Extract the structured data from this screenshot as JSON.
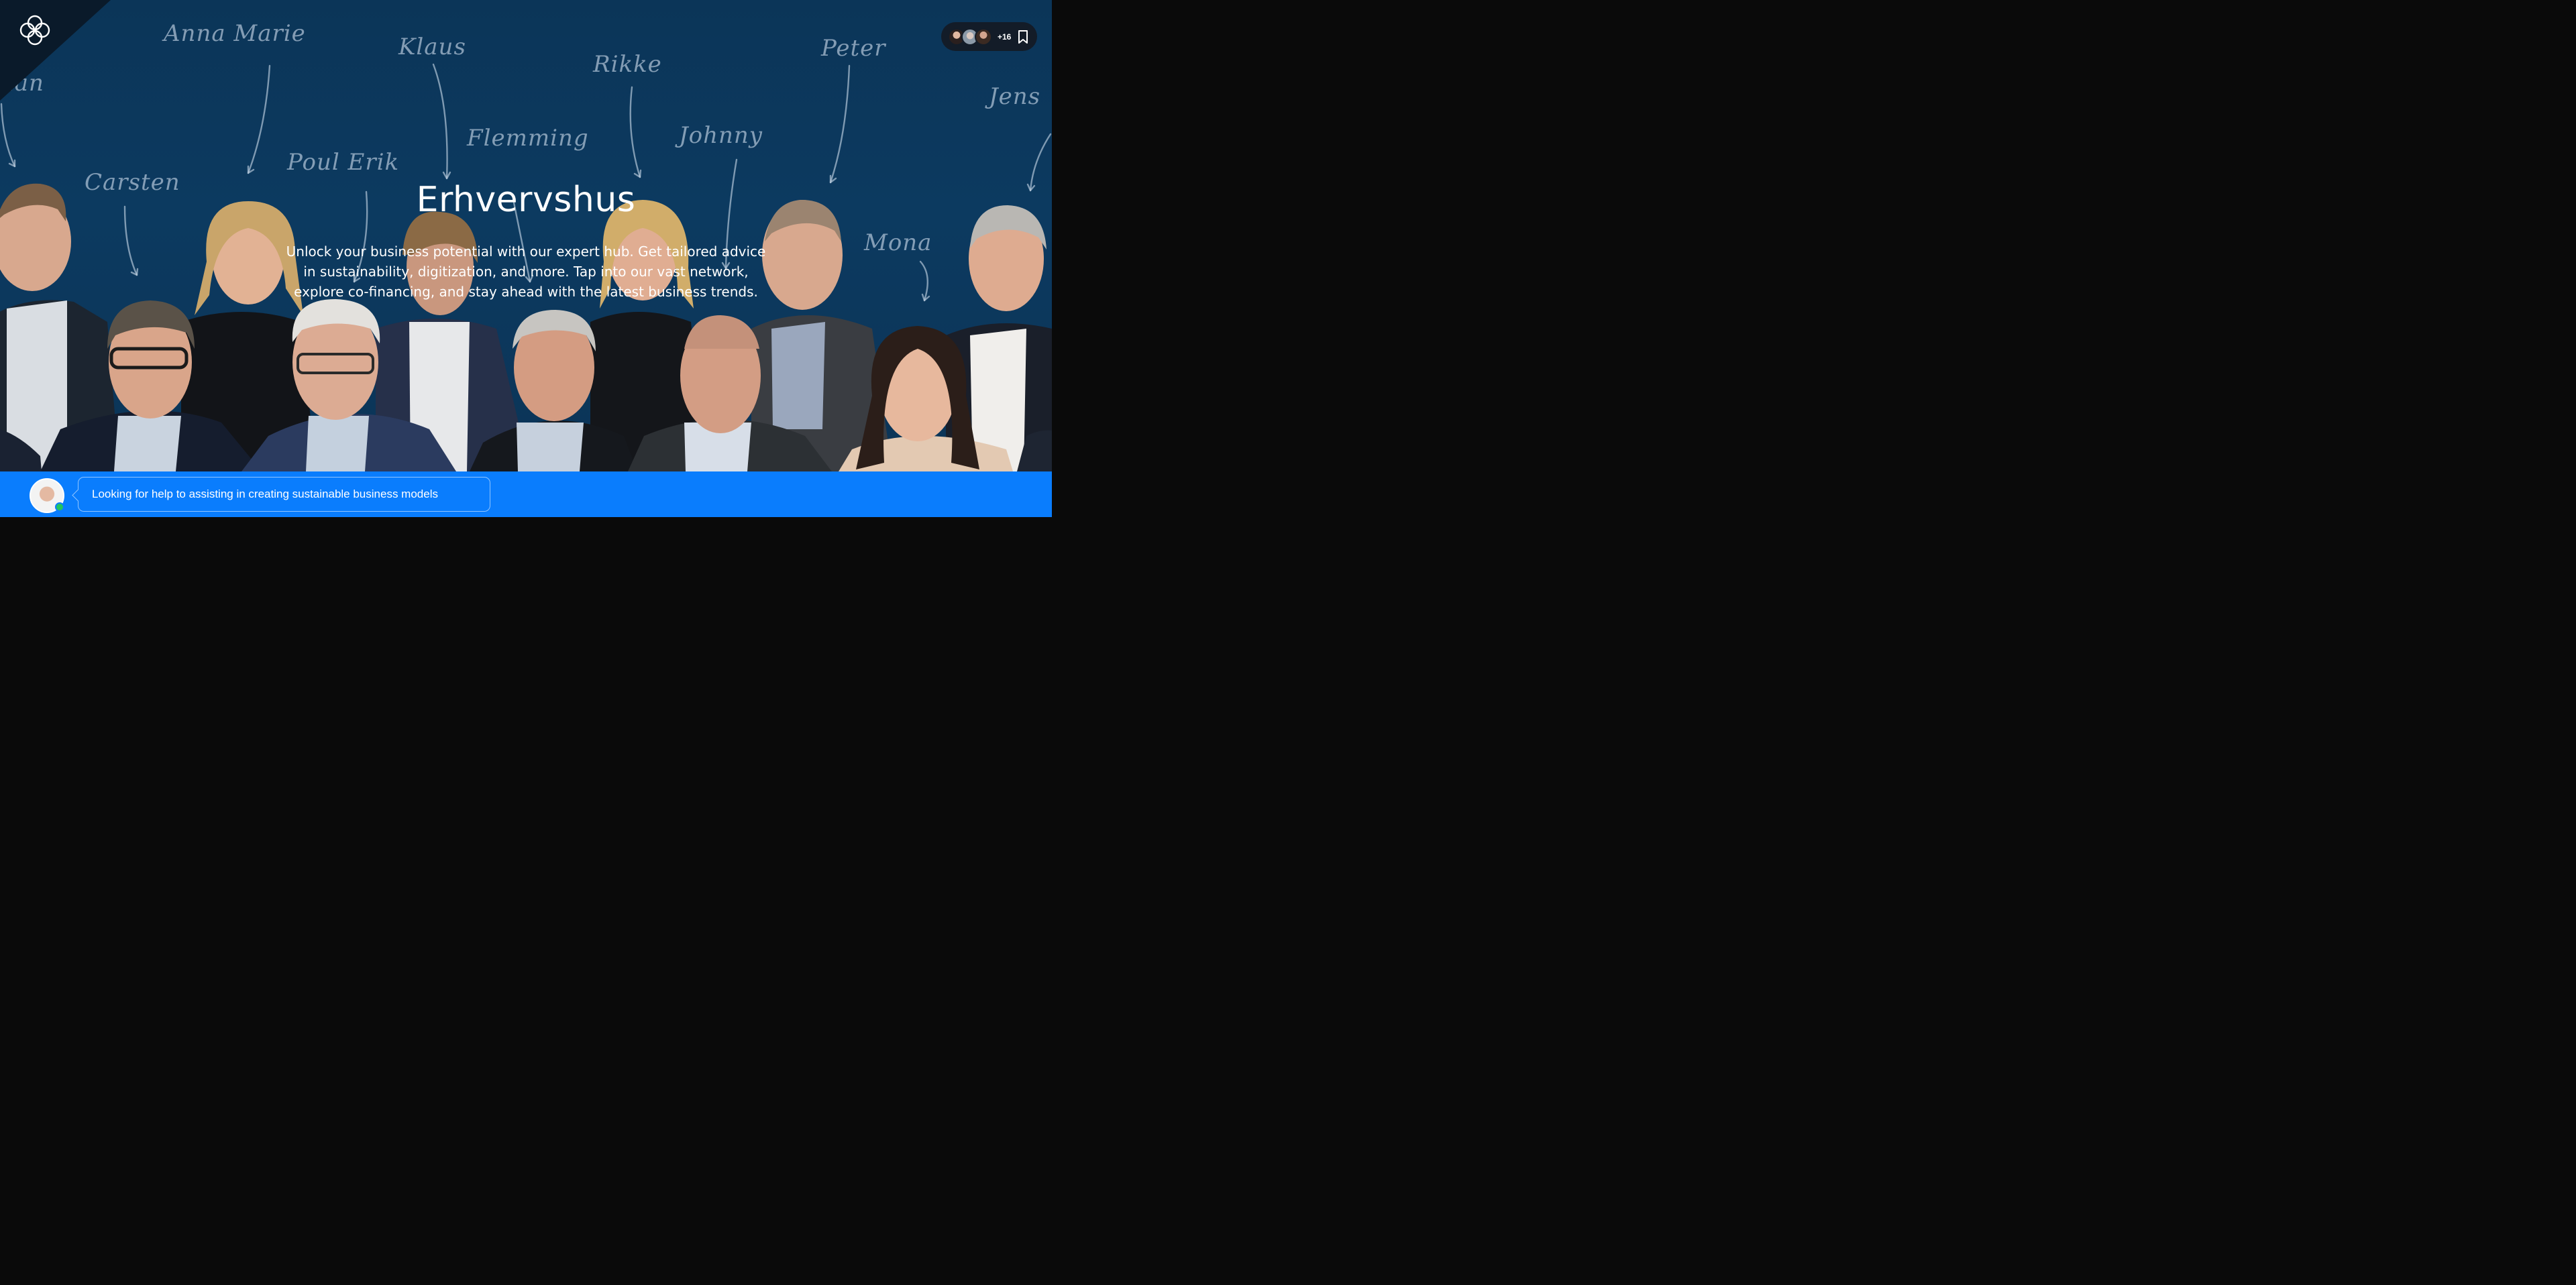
{
  "hero": {
    "title": "Erhvervshus",
    "subtitle": "Unlock your business potential with our expert hub. Get tailored advice in sustainability, digitization, and more. Tap into our vast network, explore co-financing, and stay ahead with the latest business trends."
  },
  "team_names": [
    "llan",
    "Anna Marie",
    "Klaus",
    "Rikke",
    "Peter",
    "Jens",
    "Carsten",
    "Poul Erik",
    "Flemming",
    "Johnny",
    "Mona"
  ],
  "header": {
    "avatar_overflow_count": "+16",
    "icons": [
      "flower-logo-icon",
      "bookmark-icon"
    ]
  },
  "chat_bar": {
    "message": "Looking for help to assisting in creating sustainable business models",
    "status": "online"
  },
  "colors": {
    "hero_bg": "#0c3a60",
    "bar_bg": "#0a7dfd",
    "pill_bg": "#131c28",
    "status_dot": "#22c55e"
  }
}
